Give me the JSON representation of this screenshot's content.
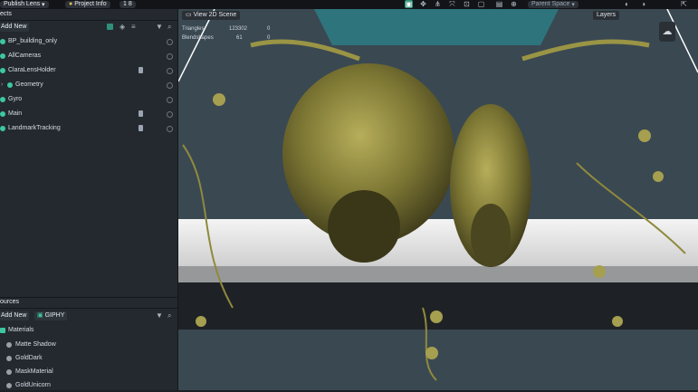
{
  "topbar": {
    "publish_label": "Publish Lens",
    "project_info_label": "Project Info",
    "badge": "1 8",
    "parent_space": "Parent Space"
  },
  "objects": {
    "title": "ects",
    "add_new": "Add New",
    "items": [
      {
        "label": "BP_building_only",
        "color": "#3ec7a0",
        "indent": 0,
        "doc": false
      },
      {
        "label": "AllCameras",
        "color": "#3ec7a0",
        "indent": 0,
        "doc": false
      },
      {
        "label": "ClaraLensHolder",
        "color": "#3ec7a0",
        "indent": 0,
        "doc": true
      },
      {
        "label": "Geometry",
        "color": "#3ec7a0",
        "indent": 1,
        "doc": false
      },
      {
        "label": "Gyro",
        "color": "#3ec7a0",
        "indent": 0,
        "doc": false
      },
      {
        "label": "Main",
        "color": "#3ec7a0",
        "indent": 0,
        "doc": true
      },
      {
        "label": "LandmarkTracking",
        "color": "#3ec7a0",
        "indent": 0,
        "doc": true
      }
    ]
  },
  "resources": {
    "title": "ources",
    "add_new": "Add New",
    "giphy": "GIPHY",
    "materials_label": "Materials",
    "items": [
      "Matte Shadow",
      "GoldDark",
      "MaskMaterial",
      "GoldUnicorn"
    ]
  },
  "viewport": {
    "view_2d": "View 2D Scene",
    "layers": "Layers",
    "stats": [
      {
        "label": "Triangles",
        "value": "123302",
        "extra": "0"
      },
      {
        "label": "Blendshapes",
        "value": "61",
        "extra": "0"
      }
    ]
  },
  "colors": {
    "accent": "#3ec7a0",
    "panel_bg": "#23292f",
    "viewport_bg": "#3b4a55",
    "gold": "#8f8a3c"
  }
}
